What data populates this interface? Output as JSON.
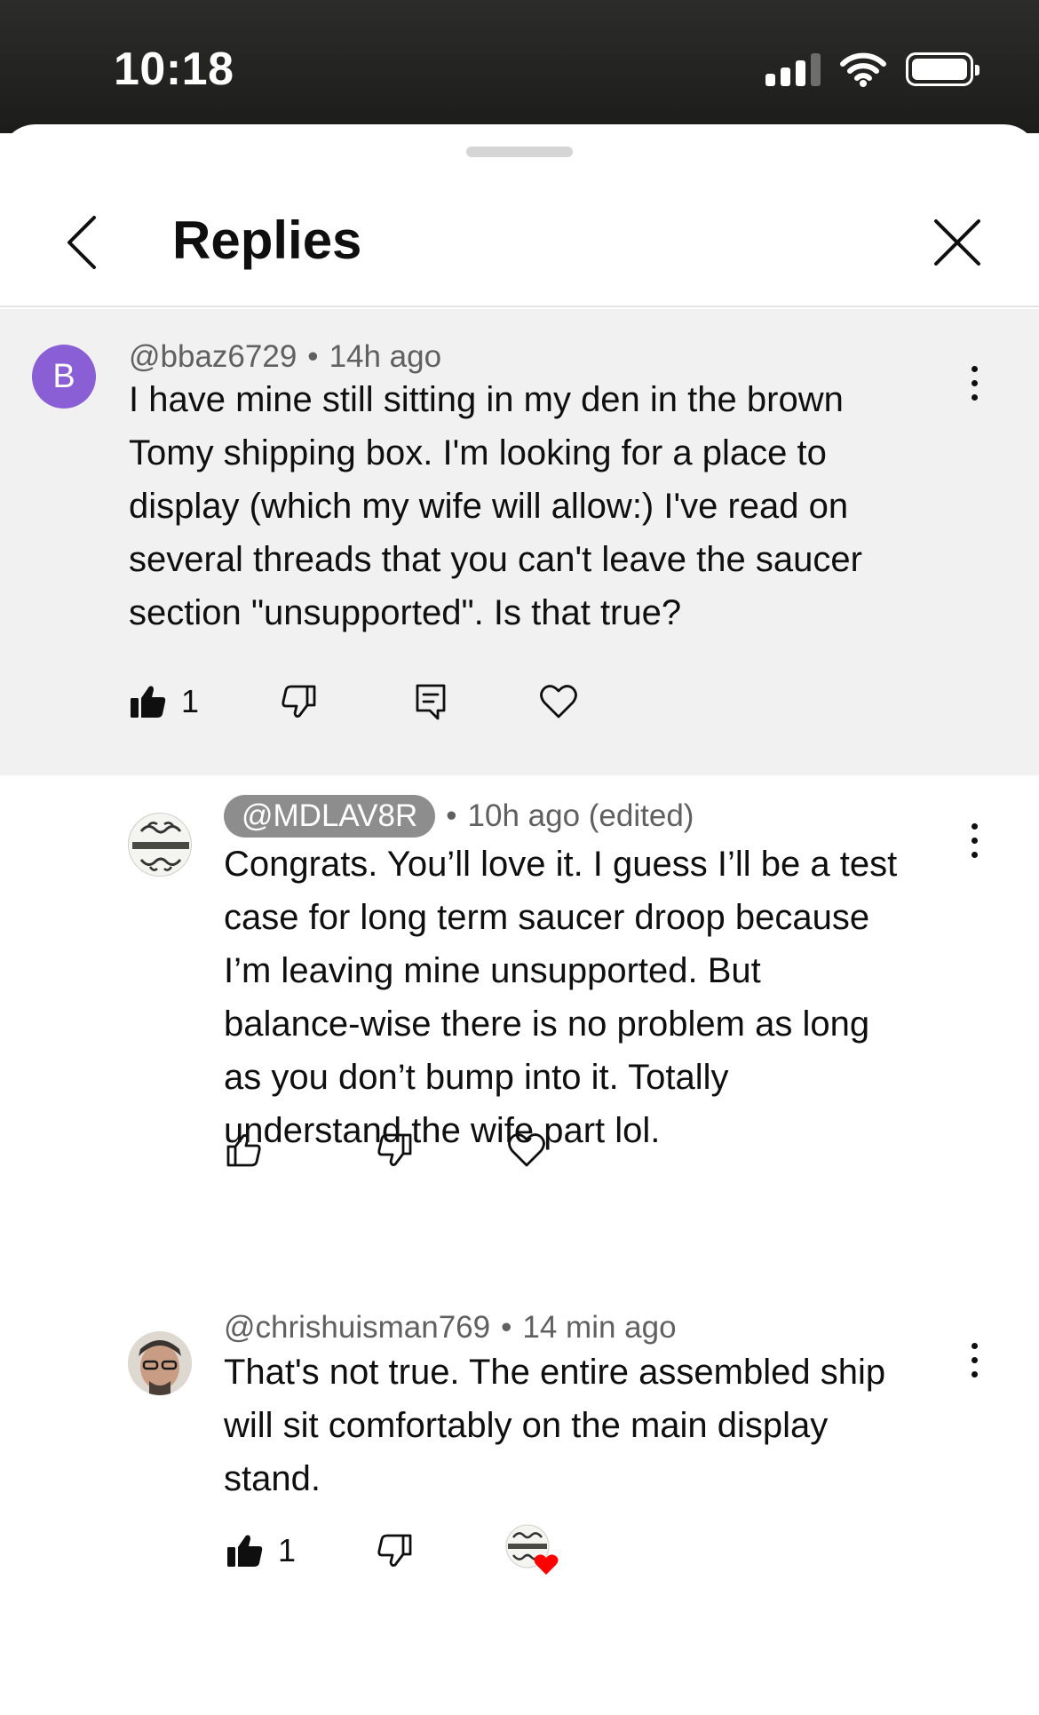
{
  "status_bar": {
    "time": "10:18",
    "icons": [
      "signal-icon",
      "wifi-icon",
      "battery-icon"
    ]
  },
  "header": {
    "title": "Replies",
    "back_icon": "chevron-left-icon",
    "close_icon": "close-icon"
  },
  "comments": [
    {
      "avatar_letter": "B",
      "avatar_color": "#8a5fd6",
      "author": "@bbaz6729",
      "separator": "•",
      "time": "14h ago",
      "lines": [
        "I have mine still sitting in my den in the brown",
        "Tomy shipping box.  I'm looking for a place to",
        "display (which my wife will allow:)  I've read on",
        "several threads that you can't leave the saucer",
        "section \"unsupported\".  Is that true?"
      ],
      "likes": "1",
      "liked": true
    },
    {
      "author": "@MDLAV8R",
      "separator": "•",
      "time": "10h ago (edited)",
      "lines": [
        "Congrats. You’ll love it. I guess I’ll be a test",
        "case for long term saucer droop because",
        "I’m leaving mine unsupported. But",
        "balance-wise there is no problem as long",
        "as you don’t bump into it.  Totally",
        "understand the wife part lol."
      ],
      "liked": false
    },
    {
      "author": "@chrishuisman769",
      "separator": "•",
      "time": "14 min ago",
      "lines": [
        "That's not true. The entire assembled ship",
        "will sit comfortably on the main display",
        "stand."
      ],
      "likes": "1",
      "liked": true,
      "creator_heart": true
    }
  ],
  "colors": {
    "heart": "#ff0000",
    "pill": "#8d8d8d",
    "parent_bg": "#f1f1f1"
  }
}
